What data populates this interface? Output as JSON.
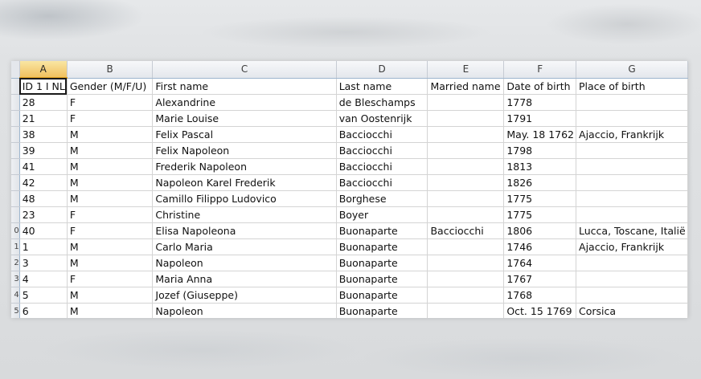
{
  "columns": [
    "A",
    "B",
    "C",
    "D",
    "E",
    "F",
    "G"
  ],
  "header_row": {
    "row_number": "",
    "cells": [
      "ID 1 I NL",
      "Gender (M/F/U)",
      "First name",
      "Last name",
      "Married name",
      "Date of birth",
      "Place of birth"
    ]
  },
  "rows": [
    {
      "row_number": "",
      "cells": [
        "28",
        "F",
        "Alexandrine",
        " de Bleschamps",
        "",
        "1778",
        ""
      ]
    },
    {
      "row_number": "",
      "cells": [
        "21",
        "F",
        "Marie Louise",
        " van Oostenrijk",
        "",
        "1791",
        ""
      ]
    },
    {
      "row_number": "",
      "cells": [
        "38",
        "M",
        "Felix Pascal",
        "Bacciocchi",
        "",
        "May. 18 1762",
        "Ajaccio, Frankrijk"
      ]
    },
    {
      "row_number": "",
      "cells": [
        "39",
        "M",
        "Felix Napoleon",
        "Bacciocchi",
        "",
        "1798",
        ""
      ]
    },
    {
      "row_number": "",
      "cells": [
        "41",
        "M",
        "Frederik Napoleon",
        "Bacciocchi",
        "",
        "1813",
        ""
      ]
    },
    {
      "row_number": "",
      "cells": [
        "42",
        "M",
        "Napoleon Karel Frederik",
        "Bacciocchi",
        "",
        "1826",
        ""
      ]
    },
    {
      "row_number": "",
      "cells": [
        "48",
        "M",
        "Camillo Filippo Ludovico",
        "Borghese",
        "",
        "1775",
        ""
      ]
    },
    {
      "row_number": "",
      "cells": [
        "23",
        "F",
        "Christine",
        "Boyer",
        "",
        "1775",
        ""
      ]
    },
    {
      "row_number": "0",
      "cells": [
        "40",
        "F",
        "Elisa Napoleona",
        "Buonaparte",
        "Bacciocchi",
        "1806",
        "Lucca, Toscane, Italië"
      ]
    },
    {
      "row_number": "1",
      "cells": [
        "1",
        "M",
        "Carlo Maria",
        "Buonaparte",
        "",
        "1746",
        "Ajaccio, Frankrijk"
      ]
    },
    {
      "row_number": "2",
      "cells": [
        "3",
        "M",
        "Napoleon",
        "Buonaparte",
        "",
        "1764",
        ""
      ]
    },
    {
      "row_number": "3",
      "cells": [
        "4",
        "F",
        "Maria Anna",
        "Buonaparte",
        "",
        "1767",
        ""
      ]
    },
    {
      "row_number": "4",
      "cells": [
        "5",
        "M",
        "Jozef (Giuseppe)",
        "Buonaparte",
        "",
        "1768",
        ""
      ]
    },
    {
      "row_number": "5",
      "cells": [
        "6",
        "M",
        "Napoleon",
        "Buonaparte",
        "",
        "Oct. 15 1769",
        "Corsica"
      ]
    }
  ],
  "colors": {
    "active_column_header": "#f1c15f",
    "grid_line": "#d4d4d4",
    "selection_border": "#1a1a1a"
  }
}
